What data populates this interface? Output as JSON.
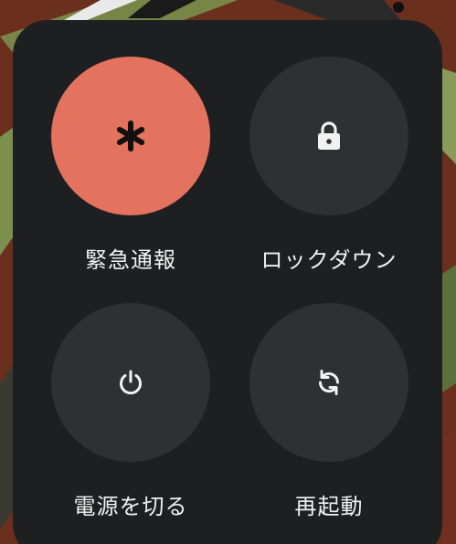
{
  "power_menu": {
    "actions": [
      {
        "id": "emergency",
        "label": "緊急通報",
        "icon": "asterisk-icon",
        "active_color": "#e3725f"
      },
      {
        "id": "lockdown",
        "label": "ロックダウン",
        "icon": "lock-icon"
      },
      {
        "id": "power_off",
        "label": "電源を切る",
        "icon": "power-icon"
      },
      {
        "id": "restart",
        "label": "再起動",
        "icon": "restart-icon"
      }
    ]
  },
  "colors": {
    "panel_background": "#1e1f20",
    "button_background": "#2f3031",
    "emergency_accent": "#e3725f",
    "label_text": "#f1f1f1"
  }
}
